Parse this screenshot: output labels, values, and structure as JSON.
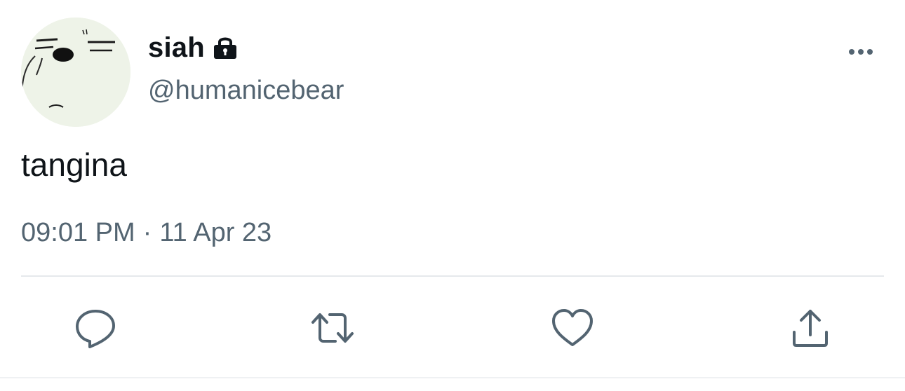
{
  "user": {
    "display_name": "siah",
    "handle": "@humanicebear",
    "avatar_icon": "cartoon-bear-face",
    "protected_icon": "lock-icon"
  },
  "tweet": {
    "text": "tangina",
    "time": "09:01 PM",
    "separator": "·",
    "date": "11 Apr 23"
  },
  "actions": {
    "more_icon": "more-horizontal-icon",
    "reply_icon": "reply-icon",
    "retweet_icon": "retweet-icon",
    "like_icon": "heart-icon",
    "share_icon": "share-icon"
  },
  "colors": {
    "text_primary": "#0f1419",
    "text_secondary": "#536471",
    "icon": "#536471",
    "divider": "#e6e9ec"
  }
}
